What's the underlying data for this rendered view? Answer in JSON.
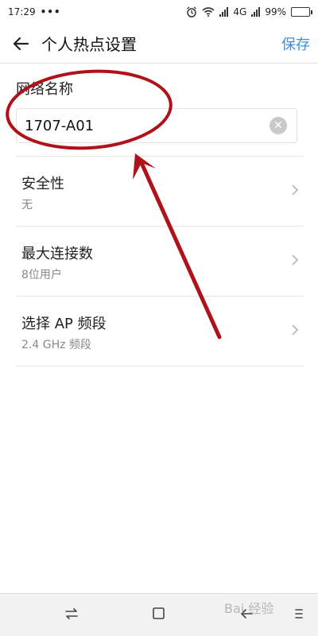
{
  "status_bar": {
    "time": "17:29",
    "dots": "•••",
    "network_type": "4G",
    "battery": "99%"
  },
  "header": {
    "title": "个人热点设置",
    "save_label": "保存",
    "back_icon": "arrow-left-icon"
  },
  "network_name": {
    "label": "网络名称",
    "value": "1707-A01",
    "clear_icon": "clear-icon"
  },
  "settings": [
    {
      "title": "安全性",
      "subtitle": "无"
    },
    {
      "title": "最大连接数",
      "subtitle": "8位用户"
    },
    {
      "title": "选择 AP 频段",
      "subtitle": "2.4 GHz 频段"
    }
  ],
  "nav_bar": {
    "icons": [
      "switch-apps-icon",
      "home-icon",
      "back-icon",
      "menu-icon"
    ]
  },
  "watermark": "Bai 经验",
  "annotation": {
    "color": "#b0121b"
  }
}
